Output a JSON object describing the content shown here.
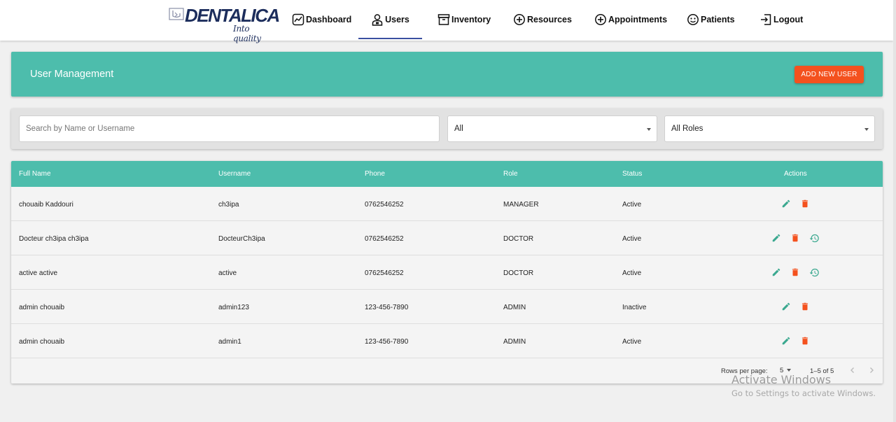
{
  "brand": {
    "name": "DENTALICA",
    "tagline": "Into quality"
  },
  "nav": {
    "items": [
      {
        "label": "Dashboard",
        "icon": "chart-line-icon"
      },
      {
        "label": "Users",
        "icon": "doctor-icon",
        "active": true
      },
      {
        "label": "Inventory",
        "icon": "archive-icon"
      },
      {
        "label": "Resources",
        "icon": "add-circle-icon"
      },
      {
        "label": "Appointments",
        "icon": "add-circle-icon"
      },
      {
        "label": "Patients",
        "icon": "face-icon"
      },
      {
        "label": "Logout",
        "icon": "logout-icon"
      }
    ]
  },
  "header": {
    "title": "User Management",
    "add_button_label": "ADD NEW USER"
  },
  "filters": {
    "search_placeholder": "Search by Name or Username",
    "search_value": "",
    "status_value": "All",
    "role_value": "All Roles"
  },
  "table": {
    "columns": [
      "Full Name",
      "Username",
      "Phone",
      "Role",
      "Status",
      "Actions"
    ],
    "rows": [
      {
        "full_name": "chouaib Kaddouri",
        "username": "ch3ipa",
        "phone": "0762546252",
        "role": "MANAGER",
        "status": "Active",
        "actions": [
          "edit-icon",
          "delete-icon"
        ]
      },
      {
        "full_name": "Docteur ch3ipa ch3ipa",
        "username": "DocteurCh3ipa",
        "phone": "0762546252",
        "role": "DOCTOR",
        "status": "Active",
        "actions": [
          "edit-icon",
          "delete-icon",
          "history-icon"
        ]
      },
      {
        "full_name": "active active",
        "username": "active",
        "phone": "0762546252",
        "role": "DOCTOR",
        "status": "Active",
        "actions": [
          "edit-icon",
          "delete-icon",
          "history-icon"
        ]
      },
      {
        "full_name": "admin chouaib",
        "username": "admin123",
        "phone": "123-456-7890",
        "role": "ADMIN",
        "status": "Inactive",
        "actions": [
          "edit-icon",
          "delete-icon"
        ]
      },
      {
        "full_name": "admin chouaib",
        "username": "admin1",
        "phone": "123-456-7890",
        "role": "ADMIN",
        "status": "Active",
        "actions": [
          "edit-icon",
          "delete-icon"
        ]
      }
    ]
  },
  "pagination": {
    "rows_per_page_label": "Rows per page:",
    "rows_per_page_value": "5",
    "range_label": "1–5 of 5"
  },
  "watermark": {
    "title": "Activate Windows",
    "subtitle": "Go to Settings to activate Windows."
  },
  "colors": {
    "accent": "#4dbdac",
    "danger": "#f4511e",
    "edit": "#3aa88f",
    "nav_underline": "#3a4fa0",
    "brand": "#1c2d5c"
  }
}
